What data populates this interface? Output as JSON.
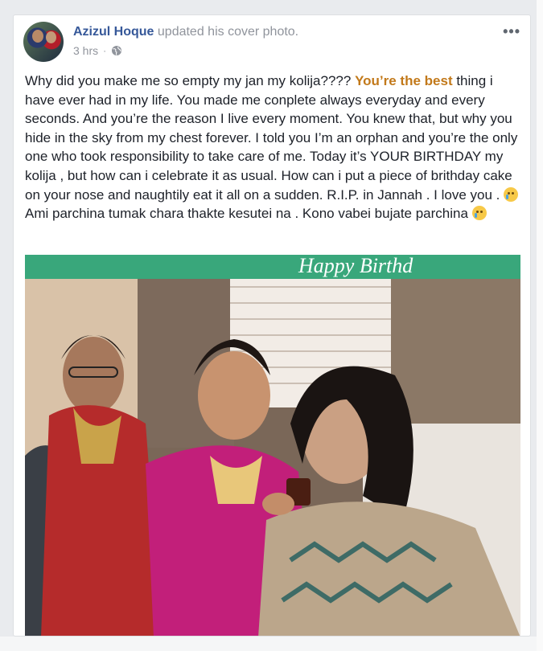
{
  "post": {
    "author": "Azizul Hoque",
    "action": "updated his cover photo.",
    "time": "3 hrs",
    "privacy_icon": "globe-icon",
    "more_icon": "ellipsis-icon",
    "text_before": "Why did you make me so empty my jan my kolija???? ",
    "highlight": "You’re the best",
    "text_after": " thing i have ever had in my life. You made me conplete always everyday and every seconds. And you’re the reason I live every moment. You knew that, but why you hide in the sky from my chest forever. I told you I’m an orphan and you’re the only one who took responsibility to take care of me. Today it’s YOUR BIRTHDAY my kolija , but how can i celebrate it as usual. How can i put a piece of brithday cake on your nose and naughtily eat it all on a sudden. R.I.P. in Jannah . I love you . ",
    "text_end1": " Ami parchina tumak chara thakte kesutei na . Kono vabei bujate parchina ",
    "emoji1": "crying-face-icon",
    "emoji2": "sad-face-icon"
  },
  "photo": {
    "banner_text": "Happy Birthd",
    "subject": "photo of women sharing birthday cake"
  },
  "colors": {
    "author": "#365899",
    "highlight": "#c2791a",
    "meta": "#90949c",
    "text": "#1d2129"
  }
}
